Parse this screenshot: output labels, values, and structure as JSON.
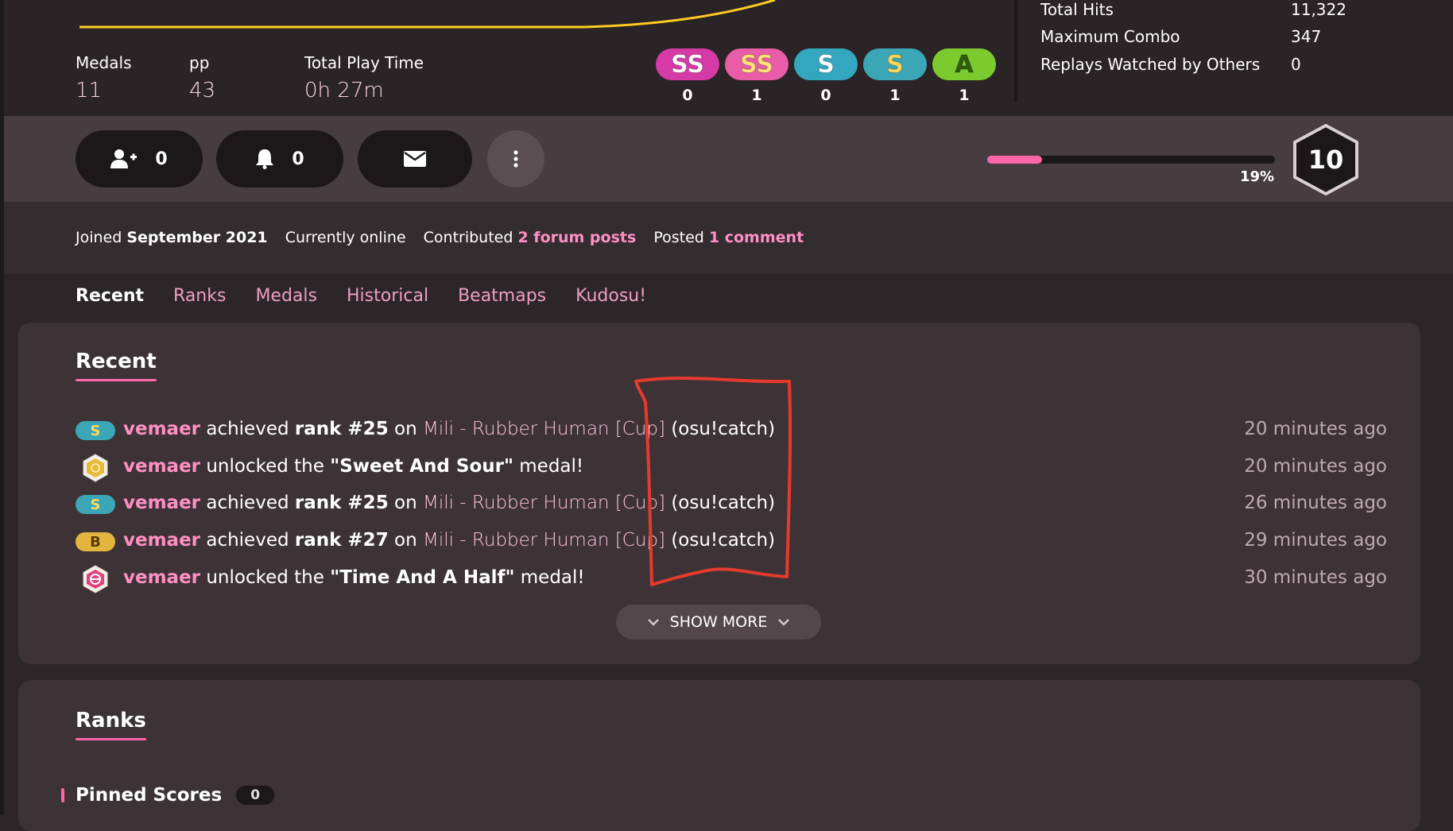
{
  "stats": {
    "medals": {
      "label": "Medals",
      "value": "11"
    },
    "pp": {
      "label": "pp",
      "value": "43"
    },
    "play_time": {
      "label": "Total Play Time",
      "value": "0h 27m"
    }
  },
  "grades": [
    {
      "grade": "SS",
      "count": "0",
      "color": "#d63aa6"
    },
    {
      "grade": "SS",
      "count": "1",
      "color": "#e85ca8"
    },
    {
      "grade": "S",
      "count": "0",
      "color": "#33a7bf"
    },
    {
      "grade": "S",
      "count": "1",
      "color": "#3ba6b5"
    },
    {
      "grade": "A",
      "count": "1",
      "color": "#7ccb2e"
    }
  ],
  "right_stats": [
    {
      "label": "Total Hits",
      "value": "11,322"
    },
    {
      "label": "Maximum Combo",
      "value": "347"
    },
    {
      "label": "Replays Watched by Others",
      "value": "0"
    }
  ],
  "actions": {
    "followers": "0",
    "mapping_subs": "0",
    "message_icon": "envelope-icon",
    "more_icon": "vertical-dots-icon"
  },
  "level": {
    "progress_percent": 19,
    "progress_label": "19%",
    "level": "10"
  },
  "info": {
    "joined_prefix": "Joined",
    "joined_date": "September 2021",
    "online": "Currently online",
    "contributed_prefix": "Contributed",
    "forum_posts": "2 forum posts",
    "posted_prefix": "Posted",
    "comments": "1 comment"
  },
  "tabs": [
    "Recent",
    "Ranks",
    "Medals",
    "Historical",
    "Beatmaps",
    "Kudosu!"
  ],
  "recent": {
    "title": "Recent",
    "items": [
      {
        "icon": "rank-S",
        "user": "vemaer",
        "verb": "achieved",
        "rank": "rank #25",
        "on": "on",
        "map": "Mili - Rubber Human [Cup]",
        "mode": "(osu!catch)",
        "time": "20 minutes ago"
      },
      {
        "icon": "medal-sweet-and-sour",
        "user": "vemaer",
        "verb": "unlocked the",
        "medal": "\"Sweet And Sour\"",
        "suffix": "medal!",
        "time": "20 minutes ago"
      },
      {
        "icon": "rank-S",
        "user": "vemaer",
        "verb": "achieved",
        "rank": "rank #25",
        "on": "on",
        "map": "Mili - Rubber Human [Cup]",
        "mode": "(osu!catch)",
        "time": "26 minutes ago"
      },
      {
        "icon": "rank-B",
        "user": "vemaer",
        "verb": "achieved",
        "rank": "rank #27",
        "on": "on",
        "map": "Mili - Rubber Human [Cup]",
        "mode": "(osu!catch)",
        "time": "29 minutes ago"
      },
      {
        "icon": "medal-time-and-a-half",
        "user": "vemaer",
        "verb": "unlocked the",
        "medal": "\"Time And A Half\"",
        "suffix": "medal!",
        "time": "30 minutes ago"
      }
    ],
    "show_more": "SHOW MORE"
  },
  "ranks": {
    "title": "Ranks",
    "pinned_label": "Pinned Scores",
    "pinned_count": "0"
  },
  "colors": {
    "accent": "#ff66aa",
    "link": "#ff8fc4",
    "annotation": "#e53a2c"
  }
}
